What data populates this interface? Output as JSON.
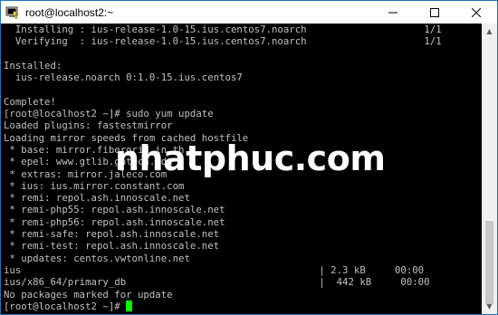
{
  "window": {
    "title": "root@localhost2:~",
    "minimize_glyph": "—",
    "maximize_glyph": "☐",
    "close_glyph": "✕",
    "border_color": "#1e73be",
    "cursor_color": "#00ff00"
  },
  "icons": {
    "app": "putty-terminal-icon",
    "minimize": "minimize-icon",
    "maximize": "maximize-icon",
    "close": "close-icon"
  },
  "terminal": {
    "lines": [
      "  Installing : ius-release-1.0-15.ius.centos7.noarch",
      "  Verifying  : ius-release-1.0-15.ius.centos7.noarch",
      "",
      "Installed:",
      "  ius-release.noarch 0:1.0-15.ius.centos7",
      "",
      "Complete!",
      "[root@localhost2 ~]# sudo yum update",
      "Loaded plugins: fastestmirror",
      "Loading mirror speeds from cached hostfile",
      " * base: mirror.fibergrid.in.th",
      " * epel: www.gtlib.gatech.edu",
      " * extras: mirror.jaleco.com",
      " * ius: ius.mirror.constant.com",
      " * remi: repol.ash.innoscale.net",
      " * remi-php55: repol.ash.innoscale.net",
      " * remi-php56: repol.ash.innoscale.net",
      " * remi-safe: repol.ash.innoscale.net",
      " * remi-test: repol.ash.innoscale.net",
      " * updates: centos.vwtonline.net",
      "ius",
      "ius/x86_64/primary_db",
      "No packages marked for update",
      "[root@localhost2 ~]# "
    ],
    "right_columns": {
      "0": "1/1",
      "1": "1/1",
      "20": "| 2.3 kB     00:00",
      "21": "|  442 kB     00:00"
    }
  },
  "watermark": {
    "text": "nhatphuc.com"
  }
}
